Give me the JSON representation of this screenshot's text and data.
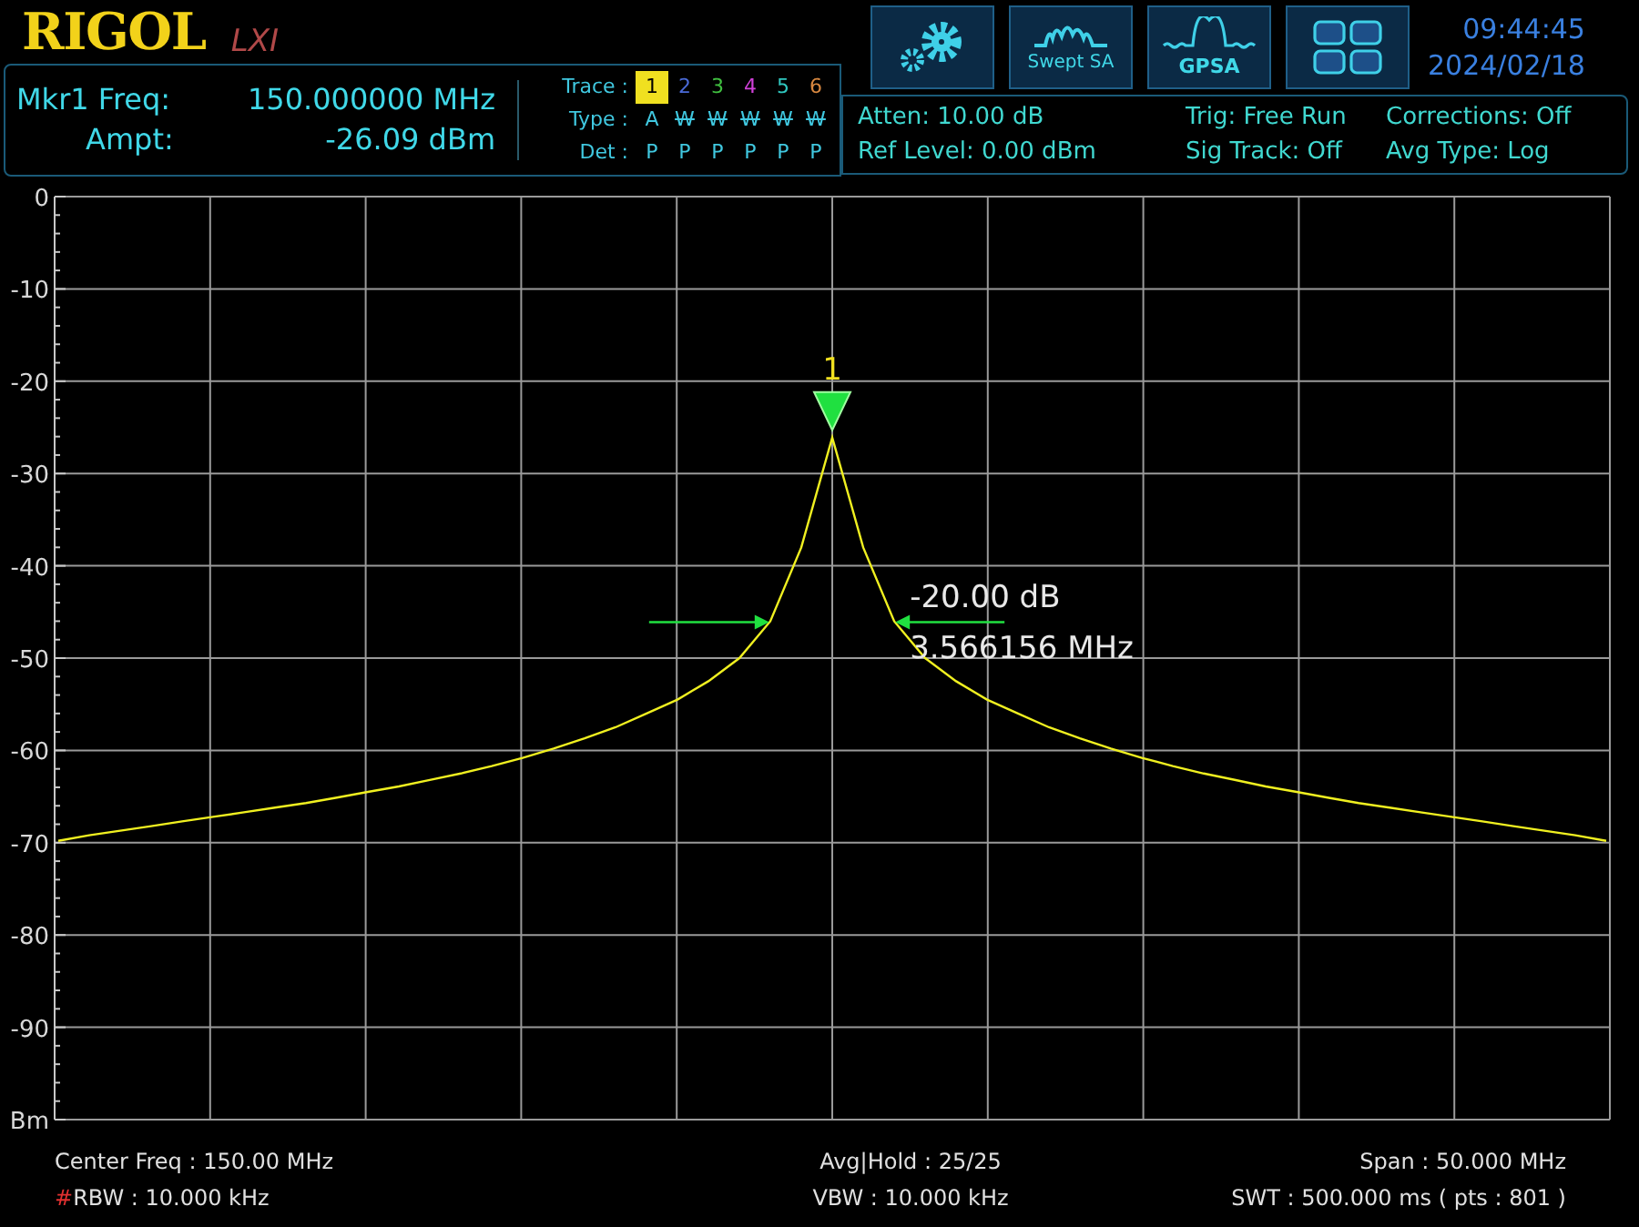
{
  "header": {
    "logo": "RIGOL",
    "logo_badge": "LXI",
    "marker": {
      "freq_label": "Mkr1 Freq:",
      "freq_value": "150.000000 MHz",
      "ampt_label": "Ampt:",
      "ampt_value": "-26.09 dBm"
    },
    "trace_table": {
      "trace_label": "Trace :",
      "type_label": "Type :",
      "det_label": "Det :",
      "traces": [
        {
          "number": "1",
          "selected": true,
          "color": "#f0e020",
          "type": "A",
          "visible": true,
          "det": "P"
        },
        {
          "number": "2",
          "selected": false,
          "color": "#4a6ad8",
          "type": "W",
          "visible": false,
          "det": "P"
        },
        {
          "number": "3",
          "selected": false,
          "color": "#40c040",
          "type": "W",
          "visible": false,
          "det": "P"
        },
        {
          "number": "4",
          "selected": false,
          "color": "#d040d8",
          "type": "W",
          "visible": false,
          "det": "P"
        },
        {
          "number": "5",
          "selected": false,
          "color": "#30c8c0",
          "type": "W",
          "visible": false,
          "det": "P"
        },
        {
          "number": "6",
          "selected": false,
          "color": "#d88840",
          "type": "W",
          "visible": false,
          "det": "P"
        }
      ]
    },
    "mode_buttons": [
      {
        "kind": "settings"
      },
      {
        "kind": "swept",
        "label": "Swept SA"
      },
      {
        "kind": "gpsa",
        "label": "GPSA"
      },
      {
        "kind": "layout"
      }
    ],
    "time": "09:44:45",
    "date": "2024/02/18",
    "settings": [
      [
        "Atten: 10.00 dB",
        "Ref Level: 0.00 dBm"
      ],
      [
        "Trig: Free Run",
        "Sig Track: Off"
      ],
      [
        "Corrections: Off",
        "Avg Type: Log"
      ]
    ]
  },
  "chart_data": {
    "type": "line",
    "grid": true,
    "ylim": [
      -100,
      0
    ],
    "ylabel": "Bm",
    "yticks": [
      0,
      -10,
      -20,
      -30,
      -40,
      -50,
      -60,
      -70,
      -80,
      -90
    ],
    "categories": [
      null,
      null,
      null,
      null,
      null,
      null,
      null,
      null,
      null,
      null,
      null,
      null,
      null,
      null,
      null,
      null,
      null,
      null,
      null,
      null,
      null,
      null,
      null,
      null,
      null,
      null,
      null,
      null,
      null,
      null,
      null,
      null,
      null,
      null,
      null,
      null,
      null,
      null,
      null,
      null,
      null,
      null,
      null,
      null,
      null,
      null,
      null,
      null,
      null,
      null,
      null
    ],
    "series": [
      {
        "color": "#f0f020",
        "values": [
          -69.8,
          -69.2,
          -68.7,
          -68.2,
          -67.7,
          -67.2,
          -66.7,
          -66.2,
          -65.7,
          -65.1,
          -64.5,
          -63.9,
          -63.2,
          -62.5,
          -61.7,
          -60.8,
          -59.8,
          -58.7,
          -57.5,
          -56,
          -54.5,
          -52.5,
          -50,
          -46,
          -38,
          -26.1,
          -38,
          -46,
          -50,
          -52.5,
          -54.5,
          -56,
          -57.5,
          -58.7,
          -59.8,
          -60.8,
          -61.7,
          -62.5,
          -63.2,
          -63.9,
          -64.5,
          -65.1,
          -65.7,
          -66.2,
          -66.7,
          -67.2,
          -67.7,
          -68.2,
          -68.7,
          -69.2,
          -69.8
        ]
      }
    ],
    "annotations": [
      {
        "text": "1"
      },
      {
        "text": "-20.00 dB"
      },
      {
        "text": "3.566156 MHz"
      }
    ]
  },
  "footer": [
    {
      "left": "Center Freq : 150.00 MHz",
      "center": "Avg|Hold : 25/25",
      "right": "Span : 50.000 MHz"
    },
    {
      "flag": "#",
      "left": "RBW : 10.000 kHz",
      "center": "VBW : 10.000 kHz",
      "right": "SWT : 500.000 ms ( pts : 801 )"
    }
  ]
}
